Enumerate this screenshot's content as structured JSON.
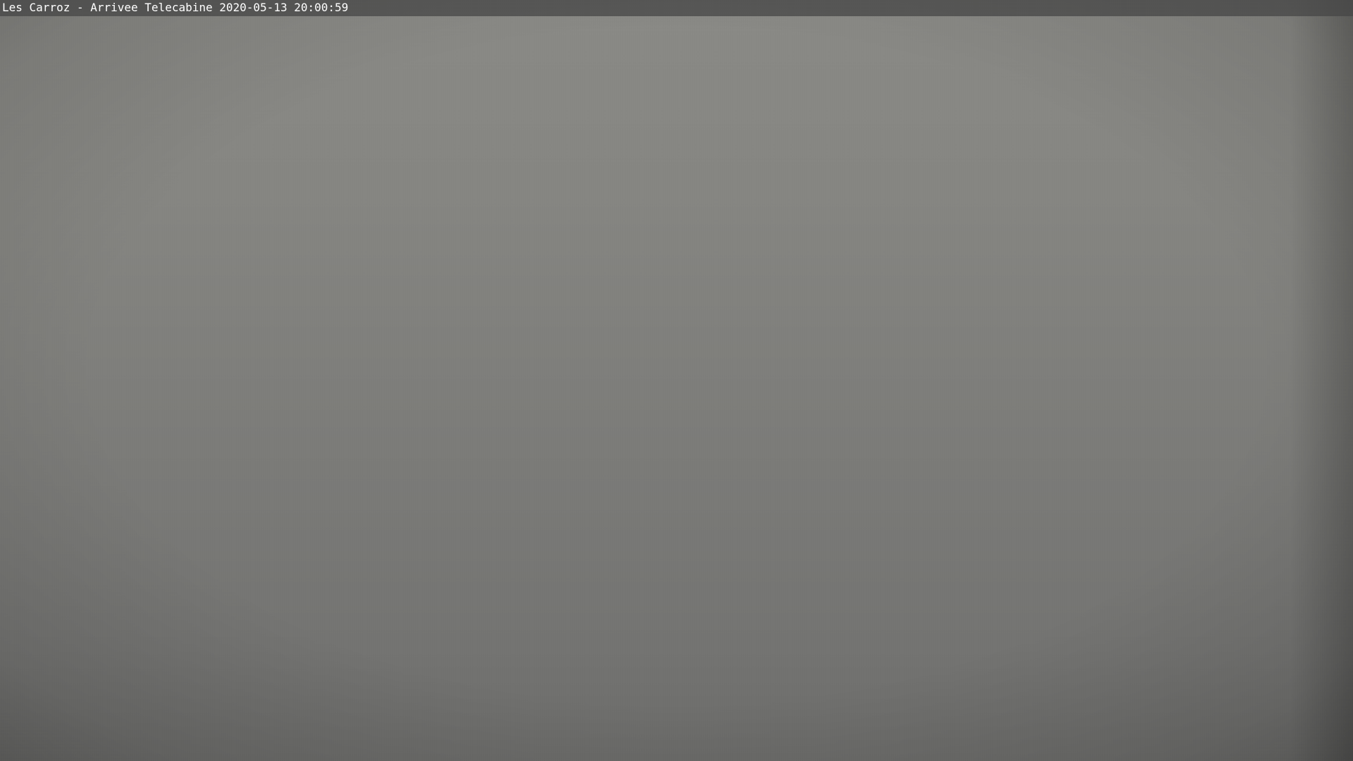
{
  "overlay": {
    "text": "Les Carroz - Arrivee Telecabine 2020-05-13 20:00:59"
  },
  "scene": {
    "sky_color": "#868682",
    "lower_color": "#6c6c6a",
    "overlay_bar_color": "#464646"
  }
}
